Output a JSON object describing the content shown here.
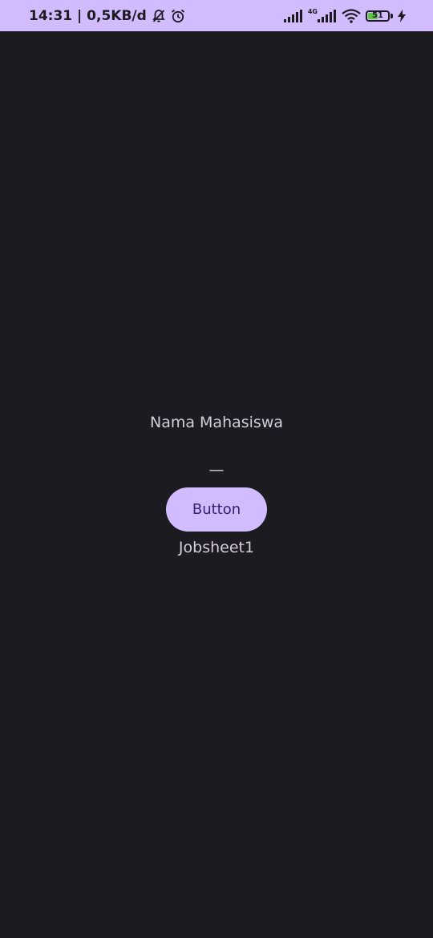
{
  "status_bar": {
    "time_speed": "14:31 | 0,5KB/d",
    "network_type": "4G",
    "battery_level": "51",
    "battery_fraction": 0.51,
    "icons": [
      "muted-bell-icon",
      "alarm-icon",
      "signal-icon",
      "signal-4g-icon",
      "wifi-icon",
      "battery-icon",
      "charging-icon"
    ],
    "background": "#d0bcff",
    "battery_color": "#5ec73f"
  },
  "main": {
    "name_label": "Nama Mahasiswa",
    "dash_text": "—",
    "button_label": "Button",
    "footer_label": "Jobsheet1",
    "background": "#1c1b20",
    "accent": "#d0bcff",
    "button_text_color": "#381e72"
  }
}
